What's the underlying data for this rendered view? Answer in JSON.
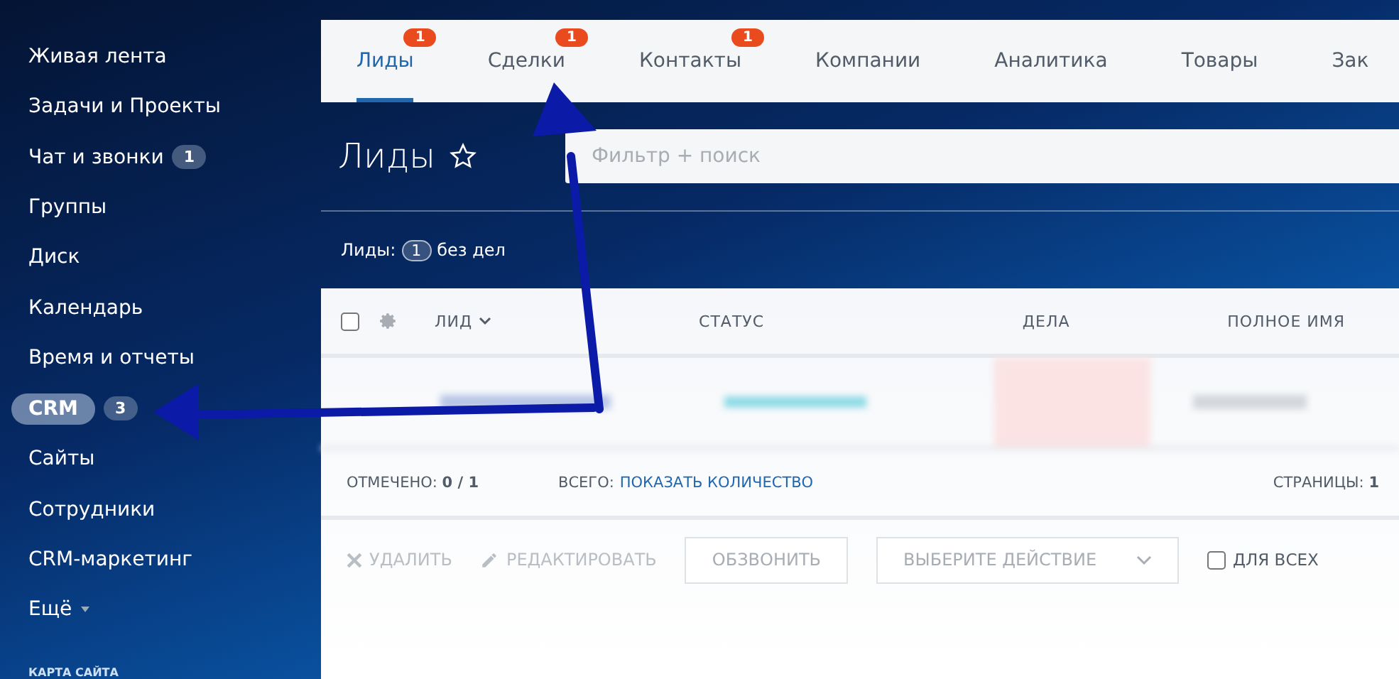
{
  "sidebar": {
    "items": [
      {
        "label": "Живая лента",
        "selected": false
      },
      {
        "label": "Задачи и Проекты",
        "selected": false
      },
      {
        "label": "Чат и звонки",
        "selected": false,
        "counter": "1"
      },
      {
        "label": "Группы",
        "selected": false
      },
      {
        "label": "Диск",
        "selected": false
      },
      {
        "label": "Календарь",
        "selected": false
      },
      {
        "label": "Время и отчеты",
        "selected": false
      },
      {
        "label": "CRM",
        "selected": true,
        "counter": "3"
      },
      {
        "label": "Сайты",
        "selected": false
      },
      {
        "label": "Сотрудники",
        "selected": false
      },
      {
        "label": "CRM-маркетинг",
        "selected": false
      },
      {
        "label": "Ещё",
        "selected": false,
        "dropdown": true
      }
    ],
    "footer": "КАРТА САЙТА"
  },
  "tabs": [
    {
      "label": "Лиды",
      "selected": true,
      "counter": "1"
    },
    {
      "label": "Сделки",
      "selected": false,
      "counter": "1"
    },
    {
      "label": "Контакты",
      "selected": false,
      "counter": "1"
    },
    {
      "label": "Компании",
      "selected": false
    },
    {
      "label": "Аналитика",
      "selected": false
    },
    {
      "label": "Товары",
      "selected": false
    },
    {
      "label": "Зак",
      "selected": false
    }
  ],
  "page_title": "Лиды",
  "filter": {
    "placeholder": "Фильтр + поиск"
  },
  "summary": {
    "label": "Лиды:",
    "count": "1",
    "suffix": "без дел"
  },
  "table": {
    "select_all_checked": false,
    "columns": [
      "ЛИД",
      "СТАТУС",
      "ДЕЛА",
      "ПОЛНОЕ ИМЯ"
    ],
    "footer": {
      "checked_label": "ОТМЕЧЕНО:",
      "checked_value": "0 / 1",
      "total_label": "ВСЕГО:",
      "total_link": "ПОКАЗАТЬ КОЛИЧЕСТВО",
      "pages_label": "СТРАНИЦЫ:",
      "pages_value": "1"
    }
  },
  "actions": {
    "delete": "УДАЛИТЬ",
    "edit": "РЕДАКТИРОВАТЬ",
    "call": "ОБЗВОНИТЬ",
    "select": "ВЫБЕРИТЕ ДЕЙСТВИЕ",
    "for_all": "ДЛЯ ВСЕХ",
    "for_all_checked": false
  }
}
